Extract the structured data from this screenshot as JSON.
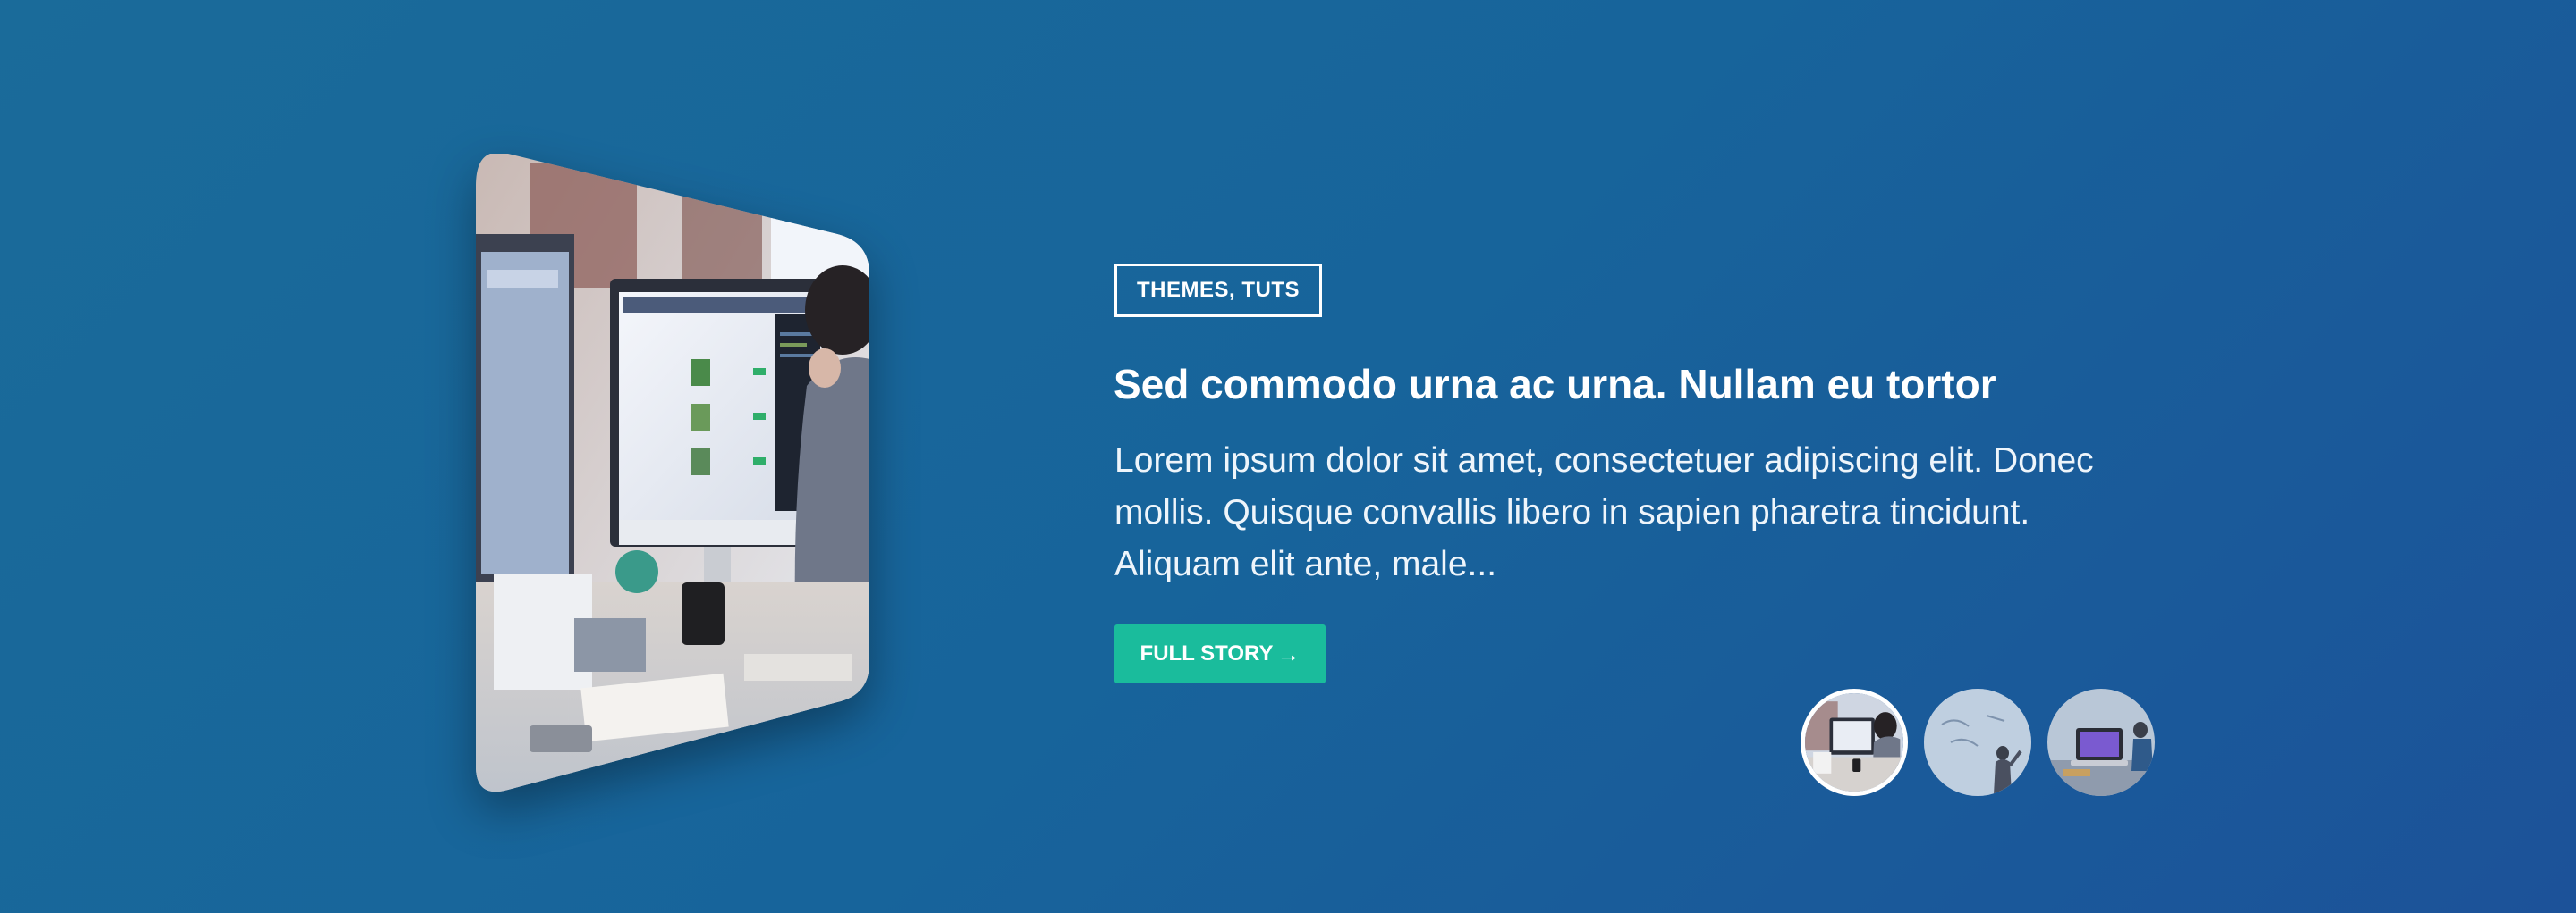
{
  "slider": {
    "category": "THEMES, TUTS",
    "title": "Sed commodo urna ac urna. Nullam eu tortor",
    "excerpt": "Lorem ipsum dolor sit amet, consectetuer adipiscing elit. Donec mollis. Quisque convallis libero in sapien pharetra tincidunt. Aliquam elit ante, male...",
    "cta_label": "FULL STORY",
    "cta_icon": "arrow-right-icon",
    "active_slide": 1
  },
  "colors": {
    "background_start": "#1a6b9a",
    "background_end": "#1c5299",
    "accent": "#1abc9c",
    "text": "#ffffff"
  }
}
